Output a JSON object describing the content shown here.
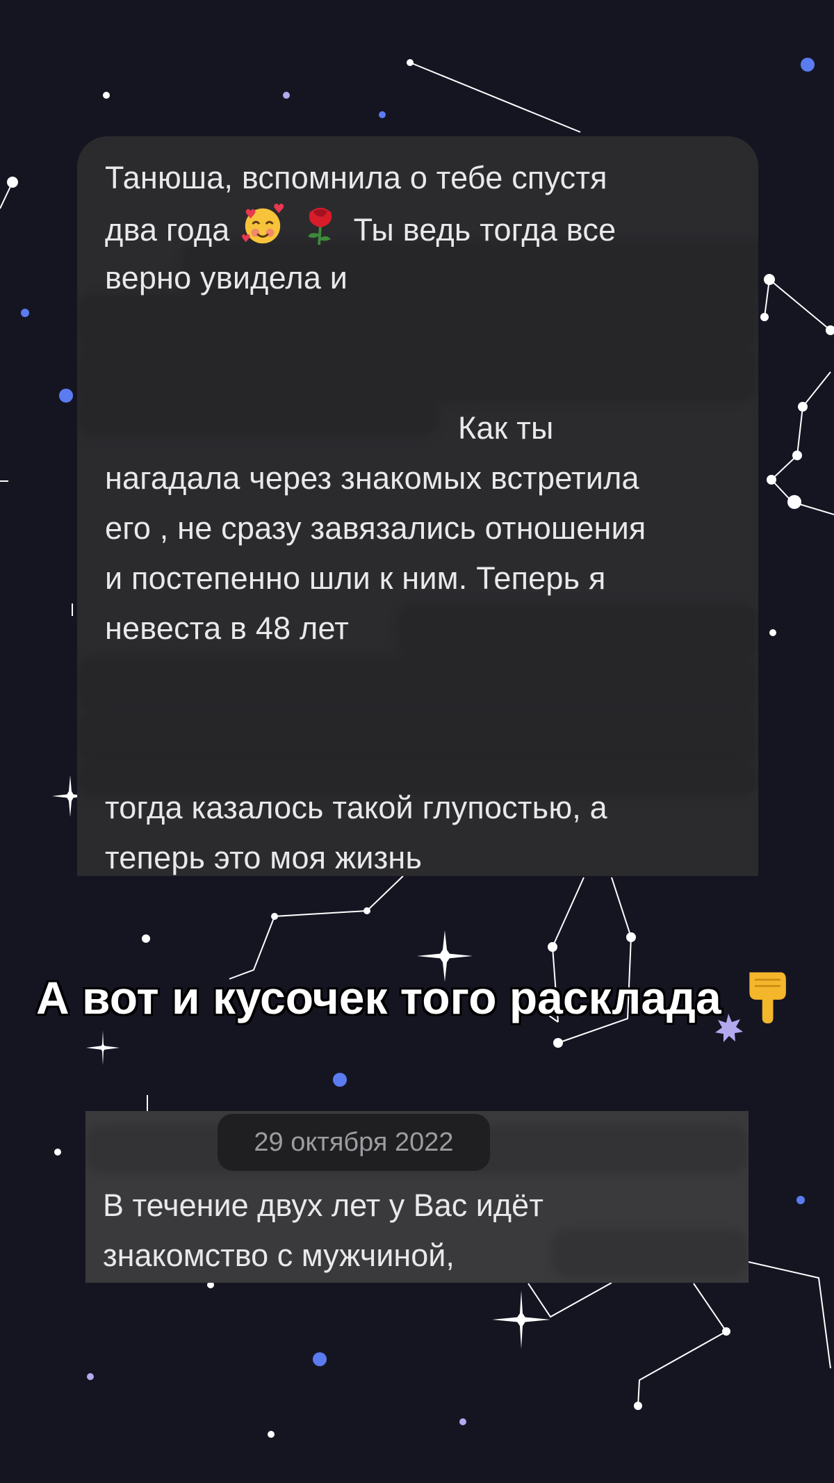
{
  "message_top": {
    "line1": "Танюша, вспомнила о тебе спустя",
    "line2_start": "два года",
    "line2_emojis": [
      "smiling-face-with-hearts-emoji",
      "rose-emoji"
    ],
    "line2_end": "Ты ведь тогда все",
    "line3": "верно увидела и",
    "line4": "Как ты",
    "line5": "нагадала через знакомых встретила",
    "line6": "его , не сразу завязались отношения",
    "line7": "и постепенно шли к ним. Теперь я",
    "line8": "невеста в 48 лет",
    "line9": "тогда казалось такой глупостью, а",
    "line10": "теперь это моя жизнь"
  },
  "caption": {
    "text": "А вот и кусочек того расклада",
    "emoji": "pointing-down-emoji"
  },
  "message_bottom": {
    "date": "29 октября 2022",
    "line1": "В течение двух лет у Вас идёт",
    "line2": "знакомство с мужчиной,"
  },
  "colors": {
    "background": "#151522",
    "bubble": "#2b2b2e",
    "bubble_bottom": "#3a3a3d",
    "text": "#e9e9ea",
    "star_blue": "#5b7cf0",
    "star_lilac": "#b3a9ee"
  }
}
